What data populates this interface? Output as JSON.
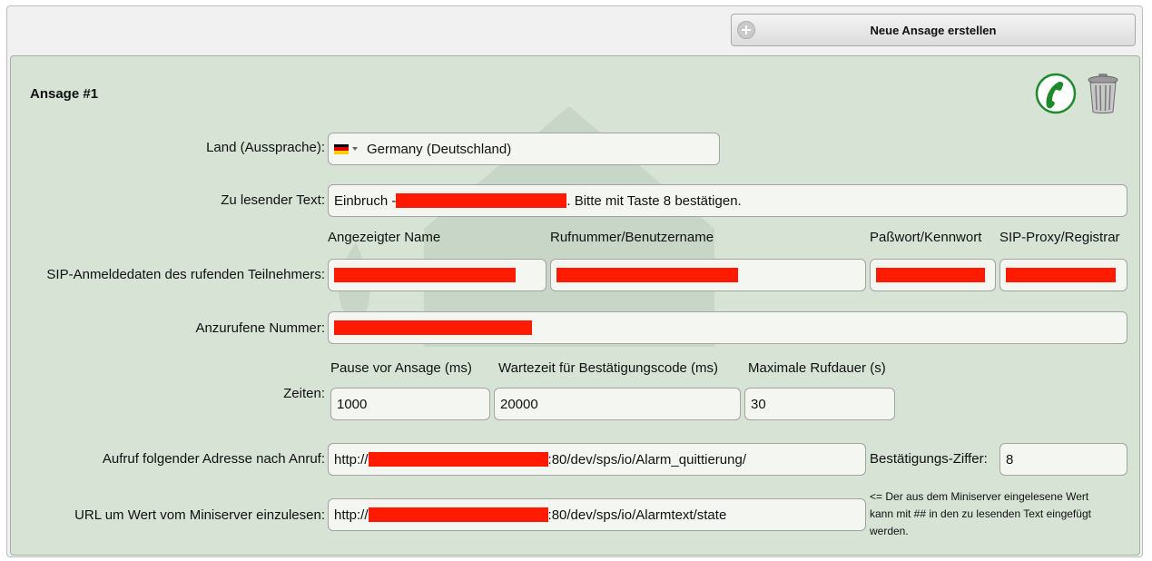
{
  "toolbar": {
    "new_announcement_label": "Neue Ansage erstellen"
  },
  "announcement": {
    "title": "Ansage #1",
    "country": {
      "label": "Land (Aussprache):",
      "value": "Germany (Deutschland)"
    },
    "text": {
      "label": "Zu lesender Text:",
      "prefix": "Einbruch -",
      "suffix": ". Bitte mit Taste 8 bestätigen."
    },
    "sip": {
      "label": "SIP-Anmeldedaten des rufenden Teilnehmers:",
      "display_name_header": "Angezeigter Name",
      "number_header": "Rufnummer/Benutzername",
      "password_header": "Paßwort/Kennwort",
      "proxy_header": "SIP-Proxy/Registrar"
    },
    "number": {
      "label": "Anzurufene Nummer:"
    },
    "times": {
      "label": "Zeiten:",
      "pause_header": "Pause vor Ansage (ms)",
      "wait_header": "Wartezeit für Bestätigungscode (ms)",
      "max_header": "Maximale Rufdauer (s)",
      "pause_value": "1000",
      "wait_value": "20000",
      "max_value": "30"
    },
    "callback": {
      "label": "Aufruf folgender Adresse nach Anruf:",
      "prefix": "http://",
      "suffix": ":80/dev/sps/io/Alarm_quittierung/",
      "digit_label": "Bestätigungs-Ziffer:",
      "digit_value": "8"
    },
    "miniserver": {
      "label": "URL um Wert vom Miniserver einzulesen:",
      "prefix": "http://",
      "suffix": ":80/dev/sps/io/Alarmtext/state",
      "note_1": "<= Der aus dem Miniserver eingelesene Wert",
      "note_2": "kann mit ## in den zu lesenden Text eingefügt",
      "note_3": "werden."
    }
  },
  "colors": {
    "panel_bg": "#d6e3d5",
    "redaction": "#ff1a00",
    "phone_green": "#1e8a2c"
  },
  "icons": {
    "add": "plus-circle-icon",
    "call": "phone-icon",
    "delete": "trash-icon",
    "country_flag": "germany-flag-icon"
  }
}
